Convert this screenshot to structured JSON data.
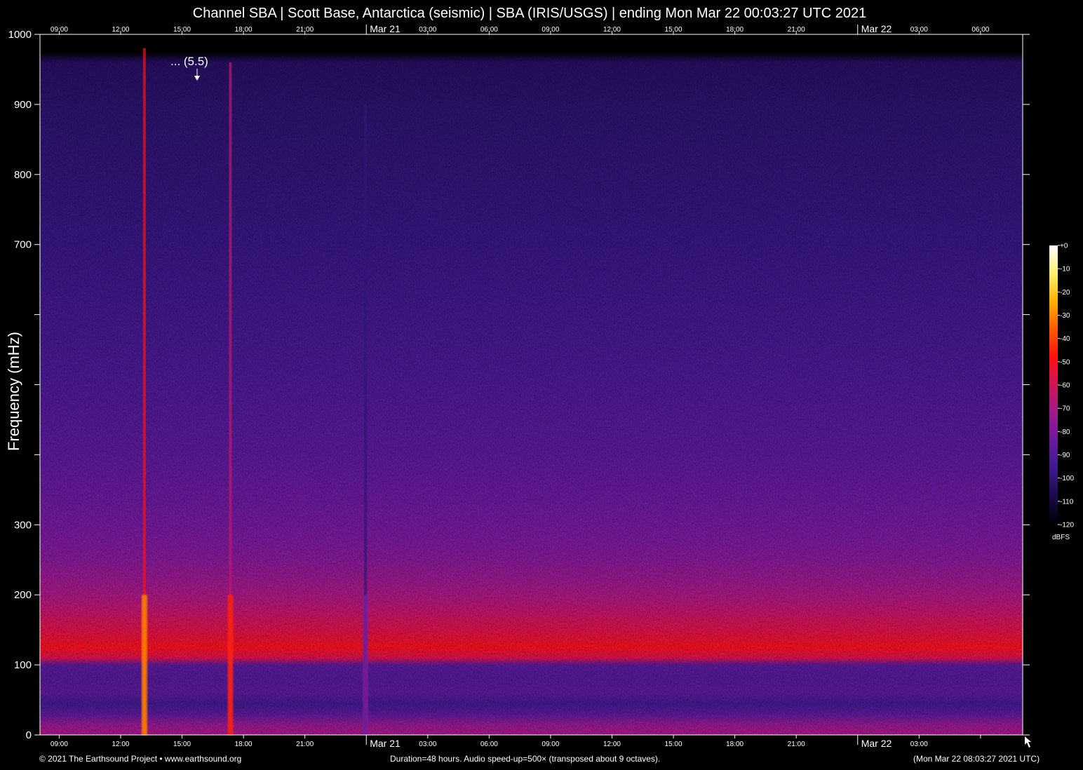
{
  "title": "Channel SBA | Scott Base, Antarctica (seismic) | SBA (IRIS/USGS) | ending Mon Mar 22 00:03:27 UTC 2021",
  "footer": {
    "copyright": "© 2021 The Earthsound Project • www.earthsound.org",
    "duration": "Duration=48 hours. Audio speed-up=500× (transposed about 9 octaves).",
    "timestamp": "(Mon Mar 22 08:03:27 2021 UTC)"
  },
  "annotation": "... (5.5)",
  "chart_data": {
    "type": "heatmap",
    "title": "Channel SBA | Scott Base, Antarctica (seismic) | SBA (IRIS/USGS) | ending Mon Mar 22 00:03:27 UTC 2021",
    "ylabel": "Frequency (mHz)",
    "xlabel": "",
    "ylim": [
      0,
      1000
    ],
    "xlim_hours": [
      0,
      48
    ],
    "x_start": "Sat Mar 20 08:03:27 UTC 2021",
    "x_end": "Mon Mar 22 08:03:27 UTC 2021",
    "y_ticks": [
      {
        "value": 0,
        "label": "0"
      },
      {
        "value": 100,
        "label": "100"
      },
      {
        "value": 200,
        "label": "200"
      },
      {
        "value": 300,
        "label": "300"
      },
      {
        "value": 400,
        "label": ""
      },
      {
        "value": 500,
        "label": ""
      },
      {
        "value": 600,
        "label": ""
      },
      {
        "value": 700,
        "label": "700"
      },
      {
        "value": 800,
        "label": "800"
      },
      {
        "value": 900,
        "label": "900"
      },
      {
        "value": 1000,
        "label": "1000"
      }
    ],
    "x_ticks_top": [
      {
        "hours": 0.94,
        "label": "09:00",
        "major": false
      },
      {
        "hours": 3.94,
        "label": "12:00",
        "major": false
      },
      {
        "hours": 6.94,
        "label": "15:00",
        "major": false
      },
      {
        "hours": 9.94,
        "label": "18:00",
        "major": false
      },
      {
        "hours": 12.94,
        "label": "21:00",
        "major": false
      },
      {
        "hours": 15.94,
        "label": "Mar 21",
        "major": true
      },
      {
        "hours": 18.94,
        "label": "03:00",
        "major": false
      },
      {
        "hours": 21.94,
        "label": "06:00",
        "major": false
      },
      {
        "hours": 24.94,
        "label": "09:00",
        "major": false
      },
      {
        "hours": 27.94,
        "label": "12:00",
        "major": false
      },
      {
        "hours": 30.94,
        "label": "15:00",
        "major": false
      },
      {
        "hours": 33.94,
        "label": "18:00",
        "major": false
      },
      {
        "hours": 36.94,
        "label": "21:00",
        "major": false
      },
      {
        "hours": 39.94,
        "label": "Mar 22",
        "major": true
      },
      {
        "hours": 42.94,
        "label": "03:00",
        "major": false
      },
      {
        "hours": 45.94,
        "label": "06:00",
        "major": false
      }
    ],
    "x_ticks_bottom": [
      {
        "hours": 0.94,
        "label": "09:00",
        "major": false
      },
      {
        "hours": 3.94,
        "label": "12:00",
        "major": false
      },
      {
        "hours": 6.94,
        "label": "15:00",
        "major": false
      },
      {
        "hours": 9.94,
        "label": "18:00",
        "major": false
      },
      {
        "hours": 12.94,
        "label": "21:00",
        "major": false
      },
      {
        "hours": 15.94,
        "label": "Mar 21",
        "major": true
      },
      {
        "hours": 18.94,
        "label": "03:00",
        "major": false
      },
      {
        "hours": 21.94,
        "label": "06:00",
        "major": false
      },
      {
        "hours": 24.94,
        "label": "09:00",
        "major": false
      },
      {
        "hours": 27.94,
        "label": "12:00",
        "major": false
      },
      {
        "hours": 30.94,
        "label": "15:00",
        "major": false
      },
      {
        "hours": 33.94,
        "label": "18:00",
        "major": false
      },
      {
        "hours": 36.94,
        "label": "21:00",
        "major": false
      },
      {
        "hours": 39.94,
        "label": "Mar 22",
        "major": true
      },
      {
        "hours": 42.94,
        "label": "03:00",
        "major": false
      },
      {
        "hours": 45.94,
        "label": ""
      }
    ],
    "colorbar": {
      "unit": "dBFS",
      "range": [
        -120,
        0
      ],
      "ticks": [
        "+0",
        "-10",
        "-20",
        "-30",
        "-40",
        "-50",
        "-60",
        "-70",
        "-80",
        "-90",
        "-100",
        "-110",
        "-120"
      ],
      "colors": [
        "#000000",
        "#1a0a4a",
        "#3d1a8c",
        "#6a1aa0",
        "#a01a8c",
        "#d0145a",
        "#ff1010",
        "#ff5a00",
        "#ffb000",
        "#fff070",
        "#ffffff"
      ]
    },
    "background_levels_dbfs": [
      {
        "freq": 0,
        "db": -70
      },
      {
        "freq": 15,
        "db": -75
      },
      {
        "freq": 30,
        "db": -88
      },
      {
        "freq": 45,
        "db": -95
      },
      {
        "freq": 60,
        "db": -88
      },
      {
        "freq": 80,
        "db": -90
      },
      {
        "freq": 100,
        "db": -88
      },
      {
        "freq": 110,
        "db": -58
      },
      {
        "freq": 125,
        "db": -50
      },
      {
        "freq": 140,
        "db": -55
      },
      {
        "freq": 170,
        "db": -62
      },
      {
        "freq": 200,
        "db": -70
      },
      {
        "freq": 250,
        "db": -78
      },
      {
        "freq": 300,
        "db": -82
      },
      {
        "freq": 400,
        "db": -88
      },
      {
        "freq": 500,
        "db": -92
      },
      {
        "freq": 700,
        "db": -98
      },
      {
        "freq": 900,
        "db": -102
      },
      {
        "freq": 960,
        "db": -104
      },
      {
        "freq": 975,
        "db": -120
      },
      {
        "freq": 1000,
        "db": -120
      }
    ],
    "events": [
      {
        "hours": 5.1,
        "label": "... (5.5)",
        "freq_top": 980,
        "peak_db": -30
      },
      {
        "hours": 9.3,
        "label": "",
        "freq_top": 960,
        "peak_db": -45
      },
      {
        "hours": 15.9,
        "label": "",
        "freq_top": 900,
        "peak_db": -80
      }
    ]
  }
}
